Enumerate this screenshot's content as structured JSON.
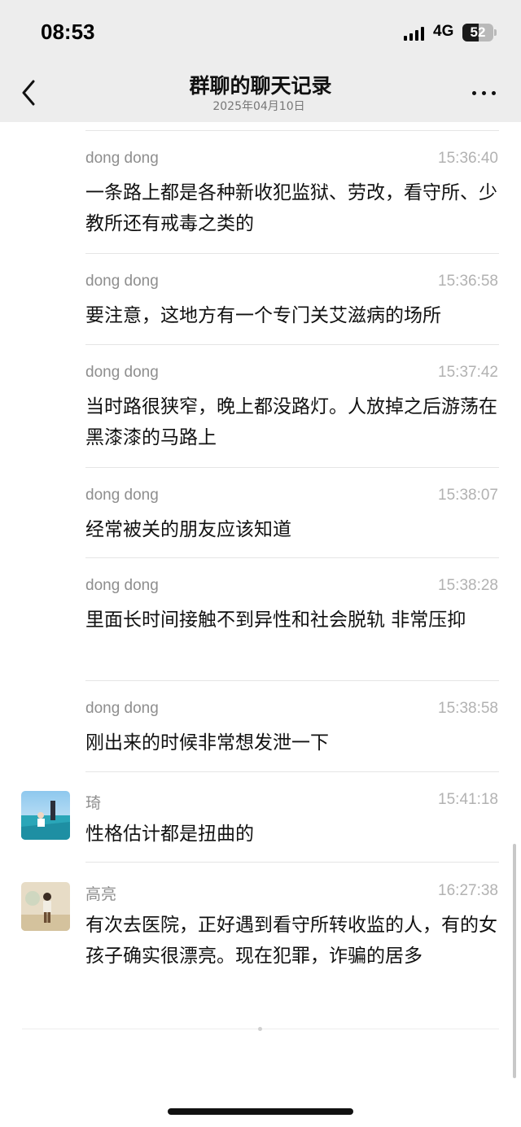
{
  "status_bar": {
    "time": "08:53",
    "network": "4G",
    "battery": "52"
  },
  "header": {
    "title": "群聊的聊天记录",
    "date": "2025年04月10日"
  },
  "messages": [
    {
      "sender": "dong dong",
      "time": "15:36:40",
      "text": "一条路上都是各种新收犯监狱、劳改，看守所、少教所还有戒毒之类的"
    },
    {
      "sender": "dong dong",
      "time": "15:36:58",
      "text": "要注意，这地方有一个专门关艾滋病的场所"
    },
    {
      "sender": "dong dong",
      "time": "15:37:42",
      "text": "当时路很狭窄，晚上都没路灯。人放掉之后游荡在黑漆漆的马路上"
    },
    {
      "sender": "dong dong",
      "time": "15:38:07",
      "text": "经常被关的朋友应该知道"
    },
    {
      "sender": "dong dong",
      "time": "15:38:28",
      "text": "里面长时间接触不到异性和社会脱轨 非常压抑"
    },
    {
      "sender": "dong dong",
      "time": "15:38:58",
      "text": "刚出来的时候非常想发泄一下"
    },
    {
      "sender": "琦",
      "time": "15:41:18",
      "text": "性格估计都是扭曲的"
    },
    {
      "sender": "高亮",
      "time": "16:27:38",
      "text": "有次去医院，正好遇到看守所转收监的人，有的女孩子确实很漂亮。现在犯罪，诈骗的居多"
    }
  ]
}
